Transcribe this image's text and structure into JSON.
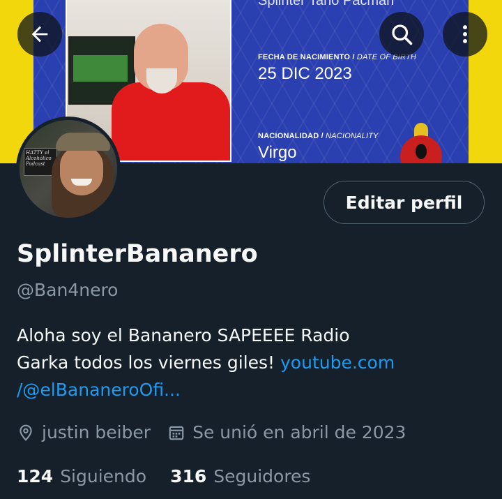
{
  "banner": {
    "cut_text": "Splinter Tano Pacman",
    "birth_label": "FECHA DE NACIMIENTO",
    "birth_label_en": "DATE OF BIRTH",
    "birth_value": "25 DIC 2023",
    "nation_label": "NACIONALIDAD",
    "nation_label_en": "NACIONALITY",
    "nation_value": "Virgo",
    "avatar_sign_text": "HATTY el Alcohólico Podcast"
  },
  "header": {
    "back_icon": "arrow-left-icon",
    "search_icon": "search-icon",
    "more_icon": "more-vertical-icon"
  },
  "profile": {
    "edit_button": "Editar perfil",
    "display_name": "SplinterBananero",
    "handle": "@Ban4nero",
    "bio_line1": "Aloha soy el Bananero SAPEEEE Radio",
    "bio_line2": "Garka todos los viernes giles! ",
    "bio_link_part1": "youtube.com",
    "bio_link_part2": "/@elBananeroOfi...",
    "location": "justin beiber",
    "joined": "Se unió en abril de 2023",
    "following_count": "124",
    "following_label": "Siguiendo",
    "followers_count": "316",
    "followers_label": "Seguidores"
  },
  "colors": {
    "background": "#15202b",
    "accent_link": "#1d9bf0",
    "muted_text": "#8b98a5",
    "banner_blue": "#2a3fb0",
    "banner_yellow": "#f3d70d"
  }
}
